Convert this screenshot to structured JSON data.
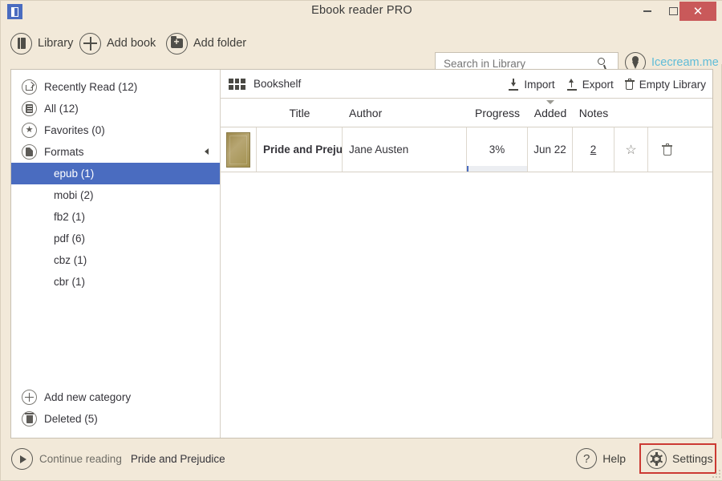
{
  "window": {
    "title": "Ebook reader PRO",
    "app_icon": "book-app-icon",
    "minimize_label": "–",
    "maximize_label": "□",
    "close_label": "✕",
    "close_color": "#c9595a"
  },
  "toolbar": {
    "items": [
      {
        "label": "Library",
        "icon": "book-icon"
      },
      {
        "label": "Add book",
        "icon": "plus-icon"
      },
      {
        "label": "Add folder",
        "icon": "folder-plus-icon"
      }
    ],
    "search": {
      "placeholder": "Search in Library",
      "value": "",
      "icon": "magnifier-icon"
    },
    "brand": {
      "label": "Icecream.me",
      "icon": "ice-cream-cone-icon",
      "color": "#5fbcd8"
    }
  },
  "sidebar": {
    "items": [
      {
        "label": "Recently Read (12)",
        "icon": "share-arrow-icon"
      },
      {
        "label": "All (12)",
        "icon": "list-icon"
      },
      {
        "label": "Favorites (0)",
        "icon": "star-icon"
      },
      {
        "label": "Formats",
        "icon": "page-icon",
        "collapse_icon": "caret-left-icon"
      }
    ],
    "formats": [
      {
        "label": "epub (1)",
        "selected": true
      },
      {
        "label": "mobi (2)",
        "selected": false
      },
      {
        "label": "fb2 (1)",
        "selected": false
      },
      {
        "label": "pdf (6)",
        "selected": false
      },
      {
        "label": "cbz (1)",
        "selected": false
      },
      {
        "label": "cbr (1)",
        "selected": false
      }
    ],
    "bottom": [
      {
        "label": "Add new category",
        "icon": "plus-circle-icon"
      },
      {
        "label": "Deleted (5)",
        "icon": "trash-icon"
      }
    ],
    "selection_color": "#4a6cc0"
  },
  "main": {
    "view_label": "Bookshelf",
    "view_icon": "grid-icon",
    "actions": [
      {
        "label": "Import",
        "icon": "import-icon"
      },
      {
        "label": "Export",
        "icon": "export-icon"
      },
      {
        "label": "Empty Library",
        "icon": "trash-icon"
      }
    ],
    "columns": [
      {
        "key": "cover",
        "label": ""
      },
      {
        "key": "title",
        "label": "Title"
      },
      {
        "key": "author",
        "label": "Author"
      },
      {
        "key": "progress",
        "label": "Progress"
      },
      {
        "key": "added",
        "label": "Added",
        "sorted": true,
        "sort_icon": "caret-down-icon"
      },
      {
        "key": "notes",
        "label": "Notes"
      },
      {
        "key": "favorite",
        "label": ""
      },
      {
        "key": "delete",
        "label": ""
      }
    ],
    "rows": [
      {
        "title": "Pride and Preju",
        "author": "Jane Austen",
        "progress_label": "3%",
        "progress_value": 3,
        "added": "Jun 22",
        "notes": "2",
        "favorite_icon": "star-outline-icon",
        "delete_icon": "trash-icon",
        "cover": "book-cover-thumbnail"
      }
    ]
  },
  "status": {
    "play_icon": "play-icon",
    "continue_label": "Continue reading",
    "continue_title": "Pride and Prejudice",
    "help": {
      "label": "Help",
      "icon": "question-mark-icon"
    },
    "settings": {
      "label": "Settings",
      "icon": "gear-icon",
      "highlight_color": "#cc3a33"
    },
    "resize_grip": "resize-grip-icon"
  }
}
